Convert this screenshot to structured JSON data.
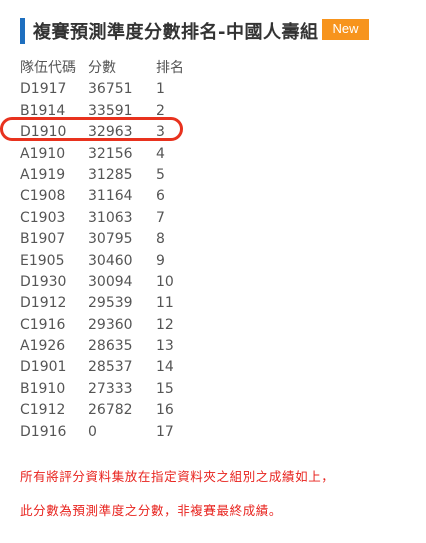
{
  "header": {
    "title": "複賽預測準度分數排名-中國人壽組",
    "badge": "New"
  },
  "table": {
    "columns": [
      "隊伍代碼",
      "分數",
      "排名"
    ],
    "rows": [
      [
        "D1917",
        "36751",
        "1"
      ],
      [
        "B1914",
        "33591",
        "2"
      ],
      [
        "D1910",
        "32963",
        "3"
      ],
      [
        "A1910",
        "32156",
        "4"
      ],
      [
        "A1919",
        "31285",
        "5"
      ],
      [
        "C1908",
        "31164",
        "6"
      ],
      [
        "C1903",
        "31063",
        "7"
      ],
      [
        "B1907",
        "30795",
        "8"
      ],
      [
        "E1905",
        "30460",
        "9"
      ],
      [
        "D1930",
        "30094",
        "10"
      ],
      [
        "D1912",
        "29539",
        "11"
      ],
      [
        "C1916",
        "29360",
        "12"
      ],
      [
        "A1926",
        "28635",
        "13"
      ],
      [
        "D1901",
        "28537",
        "14"
      ],
      [
        "B1910",
        "27333",
        "15"
      ],
      [
        "C1912",
        "26782",
        "16"
      ],
      [
        "D1916",
        "0",
        "17"
      ]
    ],
    "highlighted_team": "D1910"
  },
  "notes": [
    "所有將評分資料集放在指定資料夾之組別之成績如上，",
    "此分數為預測準度之分數，非複賽最終成績。"
  ],
  "colors": {
    "accent_bar": "#1e6fbf",
    "badge": "#f7941d",
    "note_text": "#e8231e",
    "highlight_ring": "#e8321e"
  }
}
